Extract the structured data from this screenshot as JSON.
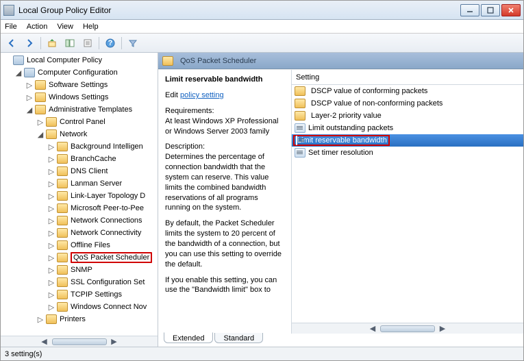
{
  "window": {
    "title": "Local Group Policy Editor"
  },
  "menu": {
    "file": "File",
    "action": "Action",
    "view": "View",
    "help": "Help"
  },
  "tree": {
    "root": "Local Computer Policy",
    "computer_config": "Computer Configuration",
    "software": "Software Settings",
    "windows": "Windows Settings",
    "admin": "Administrative Templates",
    "control_panel": "Control Panel",
    "network": "Network",
    "net_items": [
      "Background Intelligen",
      "BranchCache",
      "DNS Client",
      "Lanman Server",
      "Link-Layer Topology D",
      "Microsoft Peer-to-Pee",
      "Network Connections",
      "Network Connectivity",
      "Offline Files",
      "QoS Packet Scheduler",
      "SNMP",
      "SSL Configuration Set",
      "TCPIP Settings",
      "Windows Connect Nov"
    ],
    "printers": "Printers"
  },
  "right": {
    "header": "QoS Packet Scheduler",
    "desc_title": "Limit reservable bandwidth",
    "edit_prefix": "Edit ",
    "edit_link": "policy setting",
    "req_label": "Requirements:",
    "req_text": "At least Windows XP Professional or Windows Server 2003 family",
    "desc_label": "Description:",
    "desc_text": "Determines the percentage of connection bandwidth that the system can reserve. This value limits the combined bandwidth reservations of all programs running on the system.",
    "desc_text2": "By default, the Packet Scheduler limits the system to 20 percent of the bandwidth of a connection, but you can use this setting to override the default.",
    "desc_text3": "If you enable this setting, you can use the \"Bandwidth limit\" box to",
    "setting_header": "Setting",
    "settings": [
      "DSCP value of conforming packets",
      "DSCP value of non-conforming packets",
      "Layer-2 priority value",
      "Limit outstanding packets",
      "Limit reservable bandwidth",
      "Set timer resolution"
    ],
    "selected_index": 4
  },
  "tabs": {
    "extended": "Extended",
    "standard": "Standard"
  },
  "status": "3 setting(s)"
}
